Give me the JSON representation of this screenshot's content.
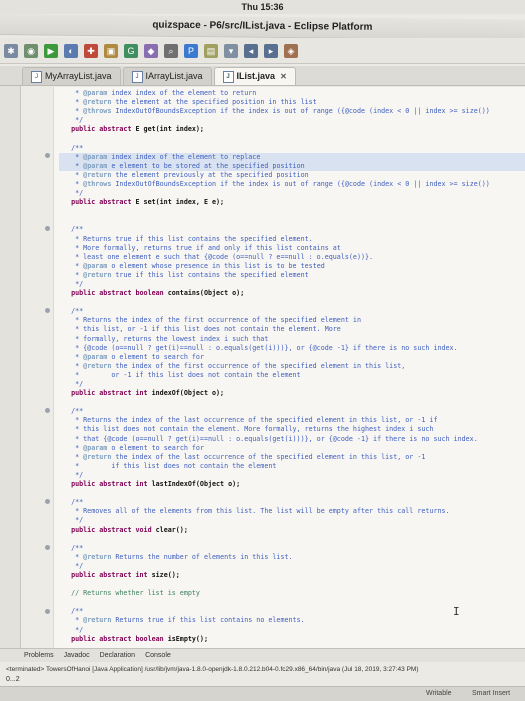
{
  "system_clock": "Thu 15:36",
  "window_title": "quizspace - P6/src/IList.java - Eclipse Platform",
  "tabs": [
    {
      "label": "MyArrayList.java",
      "active": false
    },
    {
      "label": "IArrayList.java",
      "active": false
    },
    {
      "label": "IList.java",
      "active": true
    }
  ],
  "code_lines": [
    [
      [
        "c-doc",
        "    * "
      ],
      [
        "c-tag",
        "@param"
      ],
      [
        "c-doc",
        " index index of the element to return"
      ]
    ],
    [
      [
        "c-doc",
        "    * "
      ],
      [
        "c-tag",
        "@return"
      ],
      [
        "c-doc",
        " the element at the specified position in this list"
      ]
    ],
    [
      [
        "c-doc",
        "    * "
      ],
      [
        "c-tag",
        "@throws"
      ],
      [
        "c-doc",
        " IndexOutOfBoundsException if the index is out of range ({@code (index < 0 || index >= size())"
      ]
    ],
    [
      [
        "c-doc",
        "    */"
      ]
    ],
    [
      [
        "c-kw",
        "   public abstract "
      ],
      [
        "c-txt",
        "E get(int index);"
      ]
    ],
    [
      [
        "c-txt",
        ""
      ]
    ],
    [
      [
        "c-doc",
        "   /**"
      ]
    ],
    [
      [
        "c-doc",
        "    * "
      ],
      [
        "c-tag",
        "@param"
      ],
      [
        "c-doc",
        " index index of the element to replace"
      ]
    ],
    [
      [
        "c-doc",
        "    * "
      ],
      [
        "c-tag",
        "@param"
      ],
      [
        "c-doc",
        " e element to be stored at the specified position"
      ]
    ],
    [
      [
        "c-doc",
        "    * "
      ],
      [
        "c-tag",
        "@return"
      ],
      [
        "c-doc",
        " the element previously at the specified position"
      ]
    ],
    [
      [
        "c-doc",
        "    * "
      ],
      [
        "c-tag",
        "@throws"
      ],
      [
        "c-doc",
        " IndexOutOfBoundsException if the index is out of range ({@code (index < 0 || index >= size())"
      ]
    ],
    [
      [
        "c-doc",
        "    */"
      ]
    ],
    [
      [
        "c-kw",
        "   public abstract "
      ],
      [
        "c-txt",
        "E set(int index, E e);"
      ]
    ],
    [
      [
        "c-txt",
        ""
      ]
    ],
    [
      [
        "c-txt",
        ""
      ]
    ],
    [
      [
        "c-doc",
        "   /**"
      ]
    ],
    [
      [
        "c-doc",
        "    * Returns true if this list contains the specified element."
      ]
    ],
    [
      [
        "c-doc",
        "    * More formally, returns true if and only if this list contains at"
      ]
    ],
    [
      [
        "c-doc",
        "    * least one element e such that {@code (o==null ? e==null : o.equals(e))}."
      ]
    ],
    [
      [
        "c-doc",
        "    * "
      ],
      [
        "c-tag",
        "@param"
      ],
      [
        "c-doc",
        " o element whose presence in this list is to be tested"
      ]
    ],
    [
      [
        "c-doc",
        "    * "
      ],
      [
        "c-tag",
        "@return"
      ],
      [
        "c-doc",
        " true if this list contains the specified element"
      ]
    ],
    [
      [
        "c-doc",
        "    */"
      ]
    ],
    [
      [
        "c-kw",
        "   public abstract boolean "
      ],
      [
        "c-txt",
        "contains(Object o);"
      ]
    ],
    [
      [
        "c-txt",
        ""
      ]
    ],
    [
      [
        "c-doc",
        "   /**"
      ]
    ],
    [
      [
        "c-doc",
        "    * Returns the index of the first occurrence of the specified element in"
      ]
    ],
    [
      [
        "c-doc",
        "    * this list, or -1 if this list does not contain the element. More"
      ]
    ],
    [
      [
        "c-doc",
        "    * formally, returns the lowest index i such that"
      ]
    ],
    [
      [
        "c-doc",
        "    * {@code (o==null ? get(i)==null : o.equals(get(i)))}, or {@code -1} if there is no such index."
      ]
    ],
    [
      [
        "c-doc",
        "    * "
      ],
      [
        "c-tag",
        "@param"
      ],
      [
        "c-doc",
        " o element to search for"
      ]
    ],
    [
      [
        "c-doc",
        "    * "
      ],
      [
        "c-tag",
        "@return"
      ],
      [
        "c-doc",
        " the index of the first occurrence of the specified element in this list,"
      ]
    ],
    [
      [
        "c-doc",
        "    *        or -1 if this list does not contain the element"
      ]
    ],
    [
      [
        "c-doc",
        "    */"
      ]
    ],
    [
      [
        "c-kw",
        "   public abstract int "
      ],
      [
        "c-txt",
        "indexOf(Object o);"
      ]
    ],
    [
      [
        "c-txt",
        ""
      ]
    ],
    [
      [
        "c-doc",
        "   /**"
      ]
    ],
    [
      [
        "c-doc",
        "    * Returns the index of the last occurrence of the specified element in this list, or -1 if"
      ]
    ],
    [
      [
        "c-doc",
        "    * this list does not contain the element. More formally, returns the highest index i such"
      ]
    ],
    [
      [
        "c-doc",
        "    * that {@code (o==null ? get(i)==null : o.equals(get(i)))}, or {@code -1} if there is no such index."
      ]
    ],
    [
      [
        "c-doc",
        "    * "
      ],
      [
        "c-tag",
        "@param"
      ],
      [
        "c-doc",
        " o element to search for"
      ]
    ],
    [
      [
        "c-doc",
        "    * "
      ],
      [
        "c-tag",
        "@return"
      ],
      [
        "c-doc",
        " the index of the last occurrence of the specified element in this list, or -1"
      ]
    ],
    [
      [
        "c-doc",
        "    *        if this list does not contain the element"
      ]
    ],
    [
      [
        "c-doc",
        "    */"
      ]
    ],
    [
      [
        "c-kw",
        "   public abstract int "
      ],
      [
        "c-txt",
        "lastIndexOf(Object o);"
      ]
    ],
    [
      [
        "c-txt",
        ""
      ]
    ],
    [
      [
        "c-doc",
        "   /**"
      ]
    ],
    [
      [
        "c-doc",
        "    * Removes all of the elements from this list. The list will be empty after this call returns."
      ]
    ],
    [
      [
        "c-doc",
        "    */"
      ]
    ],
    [
      [
        "c-kw",
        "   public abstract void "
      ],
      [
        "c-txt",
        "clear();"
      ]
    ],
    [
      [
        "c-txt",
        ""
      ]
    ],
    [
      [
        "c-doc",
        "   /**"
      ]
    ],
    [
      [
        "c-doc",
        "    * "
      ],
      [
        "c-tag",
        "@return"
      ],
      [
        "c-doc",
        " Returns the number of elements in this list."
      ]
    ],
    [
      [
        "c-doc",
        "    */"
      ]
    ],
    [
      [
        "c-kw",
        "   public abstract int "
      ],
      [
        "c-txt",
        "size();"
      ]
    ],
    [
      [
        "c-txt",
        ""
      ]
    ],
    [
      [
        "c-comment",
        "   // Returns whether list is empty"
      ]
    ],
    [
      [
        "c-txt",
        ""
      ]
    ],
    [
      [
        "c-doc",
        "   /**"
      ]
    ],
    [
      [
        "c-doc",
        "    * "
      ],
      [
        "c-tag",
        "@return"
      ],
      [
        "c-doc",
        " Returns true if this list contains no elements."
      ]
    ],
    [
      [
        "c-doc",
        "    */"
      ]
    ],
    [
      [
        "c-kw",
        "   public abstract boolean "
      ],
      [
        "c-txt",
        "isEmpty();"
      ]
    ],
    [
      [
        "c-txt",
        ""
      ]
    ],
    [
      [
        "c-txt",
        " }"
      ]
    ]
  ],
  "bottom_tabs": [
    "Problems",
    "Javadoc",
    "Declaration",
    "Console"
  ],
  "console_line": "<terminated> TowersOfHanoi [Java Application] /usr/lib/jvm/java-1.8.0-openjdk-1.8.0.212.b04-0.fc29.x86_64/bin/java (Jul 18, 2019, 3:27:43 PM)",
  "console_output": "0...2",
  "status": {
    "writable": "Writable",
    "insert": "Smart Insert"
  },
  "colors": {
    "accent": "#3f5fbf",
    "keyword": "#7f0055",
    "highlight": "#d8e2f0"
  }
}
